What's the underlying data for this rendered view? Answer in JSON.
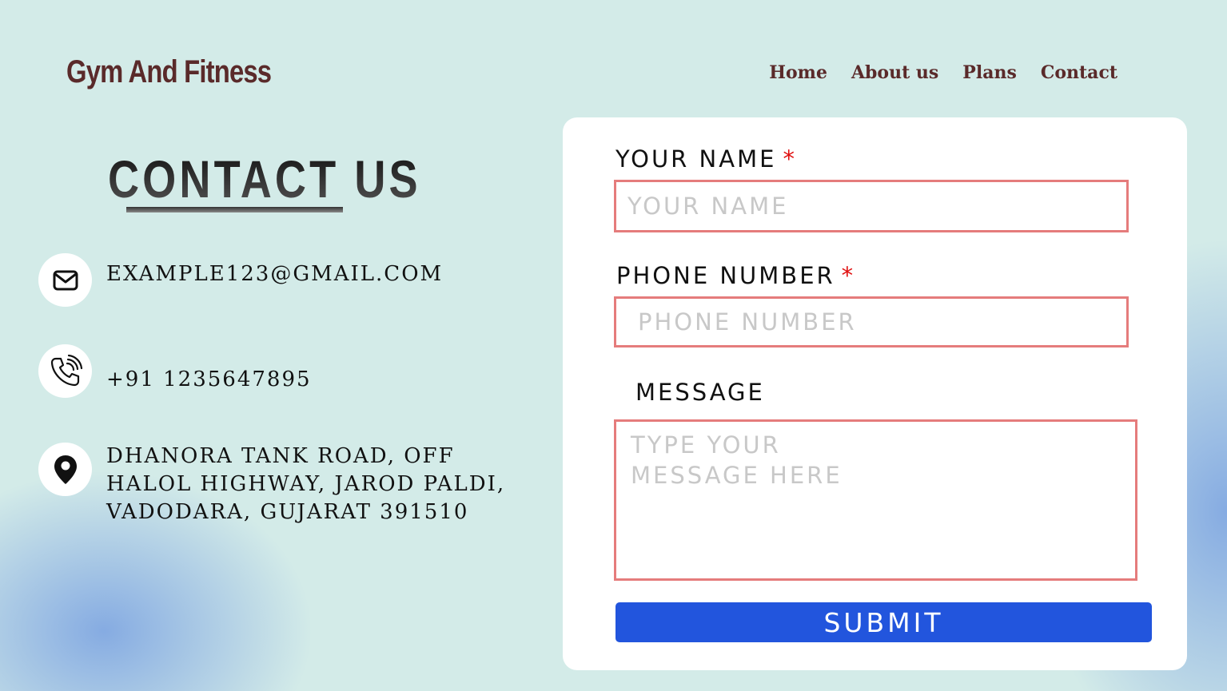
{
  "brand": "Gym And Fitness",
  "nav": [
    "Home",
    "About us",
    "Plans",
    "Contact"
  ],
  "contact": {
    "title": "CONTACT US",
    "email": "EXAMPLE123@GMAIL.COM",
    "phone": "+91 1235647895",
    "address_lines": [
      "DHANORA TANK ROAD, OFF",
      "HALOL HIGHWAY, JAROD PALDI,",
      "VADODARA, GUJARAT 391510"
    ],
    "icons": [
      "mail-icon",
      "phone-icon",
      "location-pin-icon"
    ]
  },
  "form": {
    "name_label": "YOUR NAME",
    "name_placeholder": "YOUR NAME",
    "phone_label": "PHONE NUMBER",
    "phone_placeholder": "PHONE NUMBER",
    "message_label": "MESSAGE",
    "message_placeholder": "TYPE YOUR\nMESSAGE HERE",
    "required_mark": "*",
    "submit_label": "SUBMIT"
  },
  "colors": {
    "background": "#d3ebe8",
    "brand": "#5a2a2a",
    "field_border": "#e57c7c",
    "submit": "#2255dd",
    "required": "#e01010"
  }
}
